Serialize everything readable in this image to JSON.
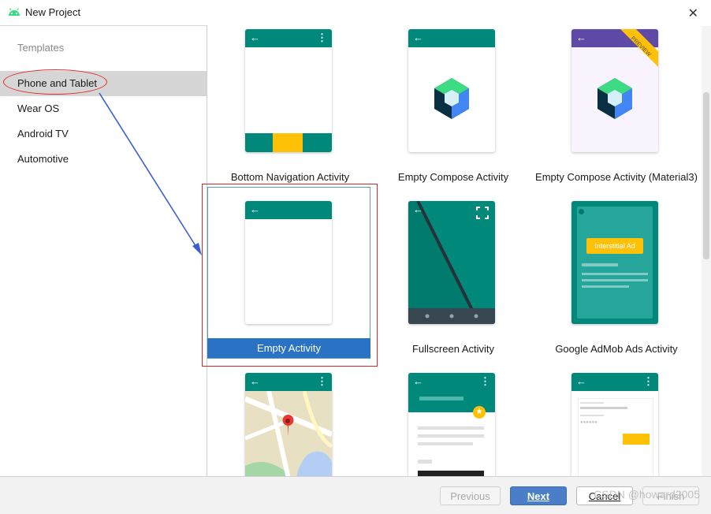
{
  "window": {
    "title": "New Project"
  },
  "sidebar": {
    "heading": "Templates",
    "items": [
      {
        "label": "Phone and Tablet",
        "selected": true
      },
      {
        "label": "Wear OS",
        "selected": false
      },
      {
        "label": "Android TV",
        "selected": false
      },
      {
        "label": "Automotive",
        "selected": false
      }
    ]
  },
  "templates": [
    {
      "label": "Bottom Navigation Activity"
    },
    {
      "label": "Empty Compose Activity"
    },
    {
      "label": "Empty Compose Activity (Material3)",
      "badge": "PREVIEW"
    },
    {
      "label": "Empty Activity",
      "selected": true
    },
    {
      "label": "Fullscreen Activity"
    },
    {
      "label": "Google AdMob Ads Activity",
      "ad_text": "Interstitial Ad"
    },
    {
      "label": ""
    },
    {
      "label": ""
    },
    {
      "label": ""
    }
  ],
  "footer": {
    "previous": "Previous",
    "next": "Next",
    "cancel": "Cancel",
    "finish": "Finish"
  },
  "watermark": "CSDN @howard2005",
  "colors": {
    "teal": "#00897b",
    "purple": "#5e4aa6",
    "selection": "#2a73c4",
    "annotation_red": "#d9252a",
    "arrow_blue": "#3b5fcf",
    "amber": "#ffc107"
  }
}
